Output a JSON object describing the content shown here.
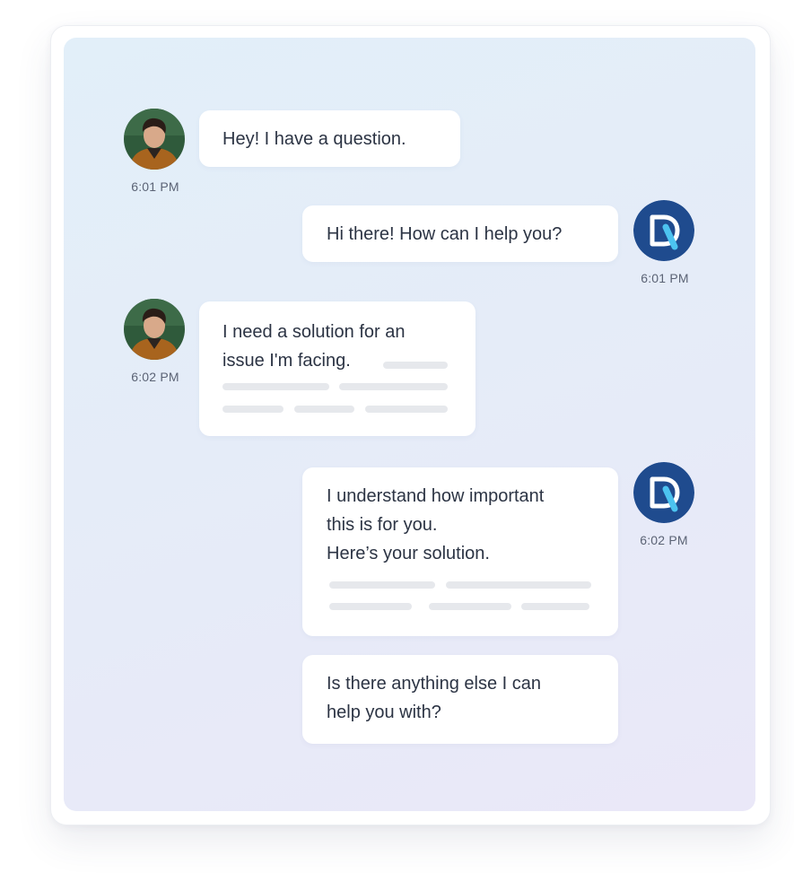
{
  "colors": {
    "bot_avatar": "#1f4b8e",
    "bot_logo_accent": "#4cc3f0",
    "placeholder_line": "#e6e8ec",
    "bubble_bg": "#ffffff"
  },
  "messages": [
    {
      "sender": "user",
      "text": "Hey! I have a question.",
      "time": "6:01 PM",
      "avatar_icon": "user-photo-avatar"
    },
    {
      "sender": "bot",
      "text": "Hi there! How can I help you?",
      "time": "6:01 PM",
      "avatar_icon": "bot-logo-icon"
    },
    {
      "sender": "user",
      "text": "I need a solution for an\nissue I'm facing.",
      "time": "6:02 PM",
      "avatar_icon": "user-photo-avatar"
    },
    {
      "sender": "bot",
      "text": "I understand how important\nthis is for you.\nHere’s your solution.",
      "time": "6:02 PM",
      "avatar_icon": "bot-logo-icon"
    },
    {
      "sender": "bot",
      "text": "Is there anything else I can\nhelp you with?"
    }
  ]
}
